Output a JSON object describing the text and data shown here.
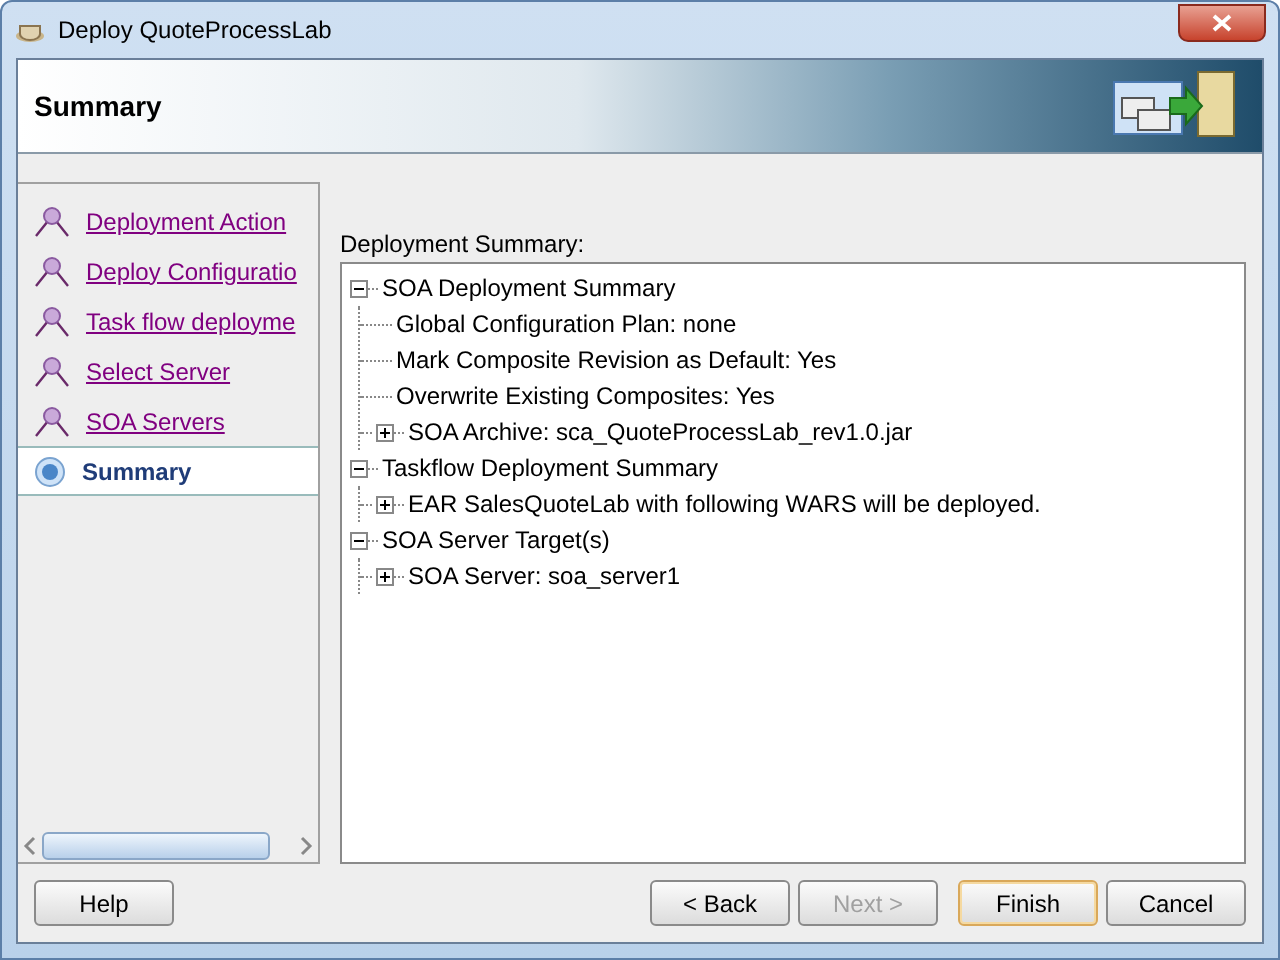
{
  "window": {
    "title": "Deploy QuoteProcessLab"
  },
  "header": {
    "title": "Summary"
  },
  "steps": [
    {
      "label": "Deployment Action",
      "selected": false
    },
    {
      "label": "Deploy Configuratio",
      "selected": false
    },
    {
      "label": "Task flow deployme",
      "selected": false
    },
    {
      "label": "Select Server",
      "selected": false
    },
    {
      "label": "SOA Servers",
      "selected": false
    },
    {
      "label": "Summary",
      "selected": true
    }
  ],
  "summary": {
    "label": "Deployment Summary:",
    "tree": [
      {
        "label": "SOA Deployment Summary",
        "kind": "group",
        "expanded": true,
        "children": [
          {
            "label": "Global Configuration Plan: none",
            "kind": "leaf"
          },
          {
            "label": "Mark Composite Revision as Default: Yes",
            "kind": "leaf"
          },
          {
            "label": "Overwrite Existing Composites: Yes",
            "kind": "leaf"
          },
          {
            "label": "SOA Archive: sca_QuoteProcessLab_rev1.0.jar",
            "kind": "group",
            "expanded": false
          }
        ]
      },
      {
        "label": "Taskflow Deployment Summary",
        "kind": "group",
        "expanded": true,
        "children": [
          {
            "label": "EAR SalesQuoteLab with following WARS will be deployed.",
            "kind": "group",
            "expanded": false
          }
        ]
      },
      {
        "label": "SOA Server Target(s)",
        "kind": "group",
        "expanded": true,
        "children": [
          {
            "label": "SOA Server: soa_server1",
            "kind": "group",
            "expanded": false
          }
        ]
      }
    ]
  },
  "buttons": [
    {
      "label": "Help",
      "disabled": false,
      "default": false
    },
    {
      "label": "< Back",
      "disabled": false,
      "default": false
    },
    {
      "label": "Next >",
      "disabled": true,
      "default": false
    },
    {
      "label": "Finish",
      "disabled": false,
      "default": true
    },
    {
      "label": "Cancel",
      "disabled": false,
      "default": false
    }
  ]
}
